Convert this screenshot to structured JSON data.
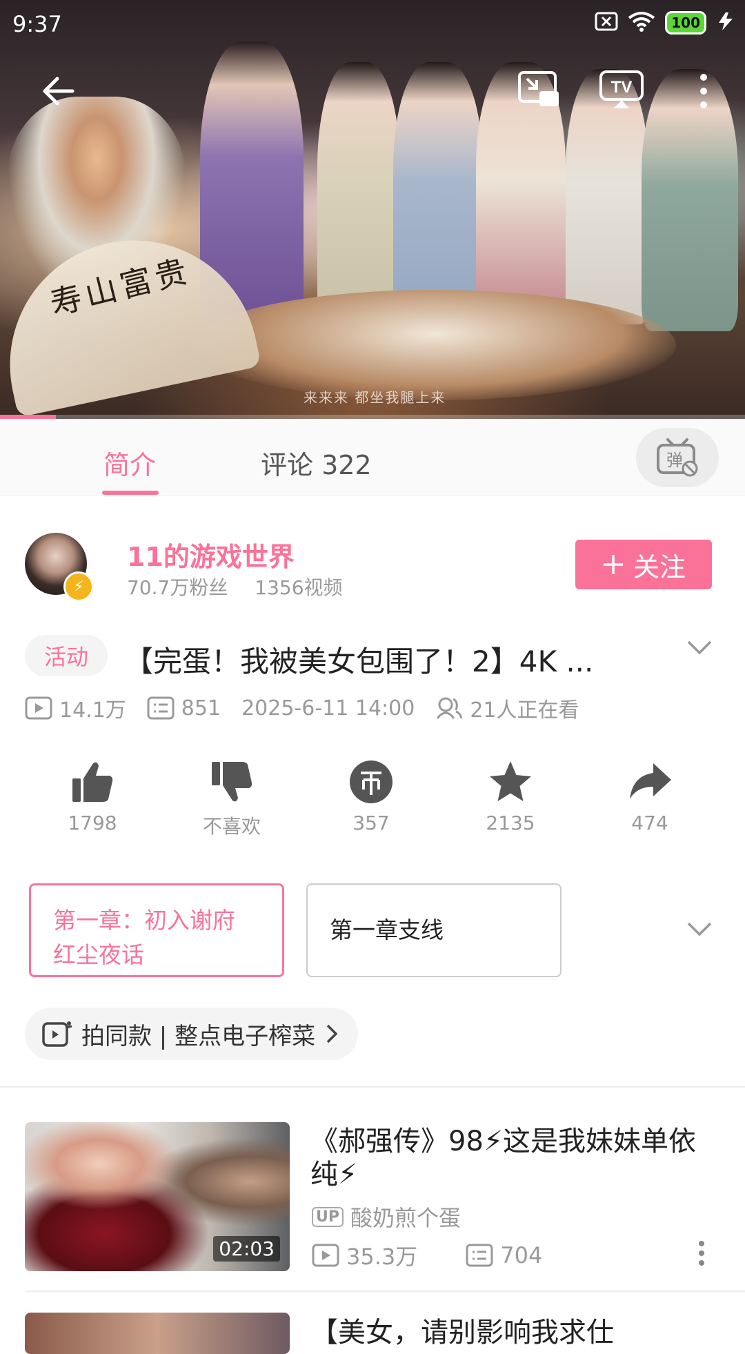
{
  "status_bar": {
    "time": "9:37",
    "battery": "100"
  },
  "player": {
    "progress": 0.075,
    "subtitle": "来来来 都坐我腿上来",
    "fan_text": "寿山富贵"
  },
  "tabs": [
    {
      "label": "简介"
    },
    {
      "label": "评论 322"
    }
  ],
  "uploader": {
    "name": "11的游戏世界",
    "followers": "70.7万粉丝",
    "videos": "1356视频",
    "follow_label": "关注"
  },
  "video": {
    "tag": "活动",
    "title": "【完蛋！我被美女包围了！2】4K ...",
    "views": "14.1万",
    "danmaku": "851",
    "date": "2025-6-11 14:00",
    "watching": "21人正在看"
  },
  "actions": [
    {
      "icon": "thumbs-up-icon",
      "label": "1798"
    },
    {
      "icon": "thumbs-down-icon",
      "label": "不喜欢"
    },
    {
      "icon": "coin-icon",
      "label": "357"
    },
    {
      "icon": "star-icon",
      "label": "2135"
    },
    {
      "icon": "share-icon",
      "label": "474"
    }
  ],
  "episodes": [
    {
      "label": "第一章：初入谢府 红尘夜话",
      "selected": true
    },
    {
      "label": "第一章支线",
      "selected": false
    }
  ],
  "shoot_same": {
    "label": "拍同款 | 整点电子榨菜"
  },
  "recommendations": [
    {
      "title": "《郝强传》98⚡这是我妹妹单依纯⚡",
      "author": "酸奶煎个蛋",
      "up_tag": "UP",
      "duration": "02:03",
      "views": "35.3万",
      "danmaku": "704"
    },
    {
      "title": "【美女，请别影响我求仕"
    }
  ],
  "colors": {
    "accent": "#fb7299",
    "muted": "#999999"
  }
}
